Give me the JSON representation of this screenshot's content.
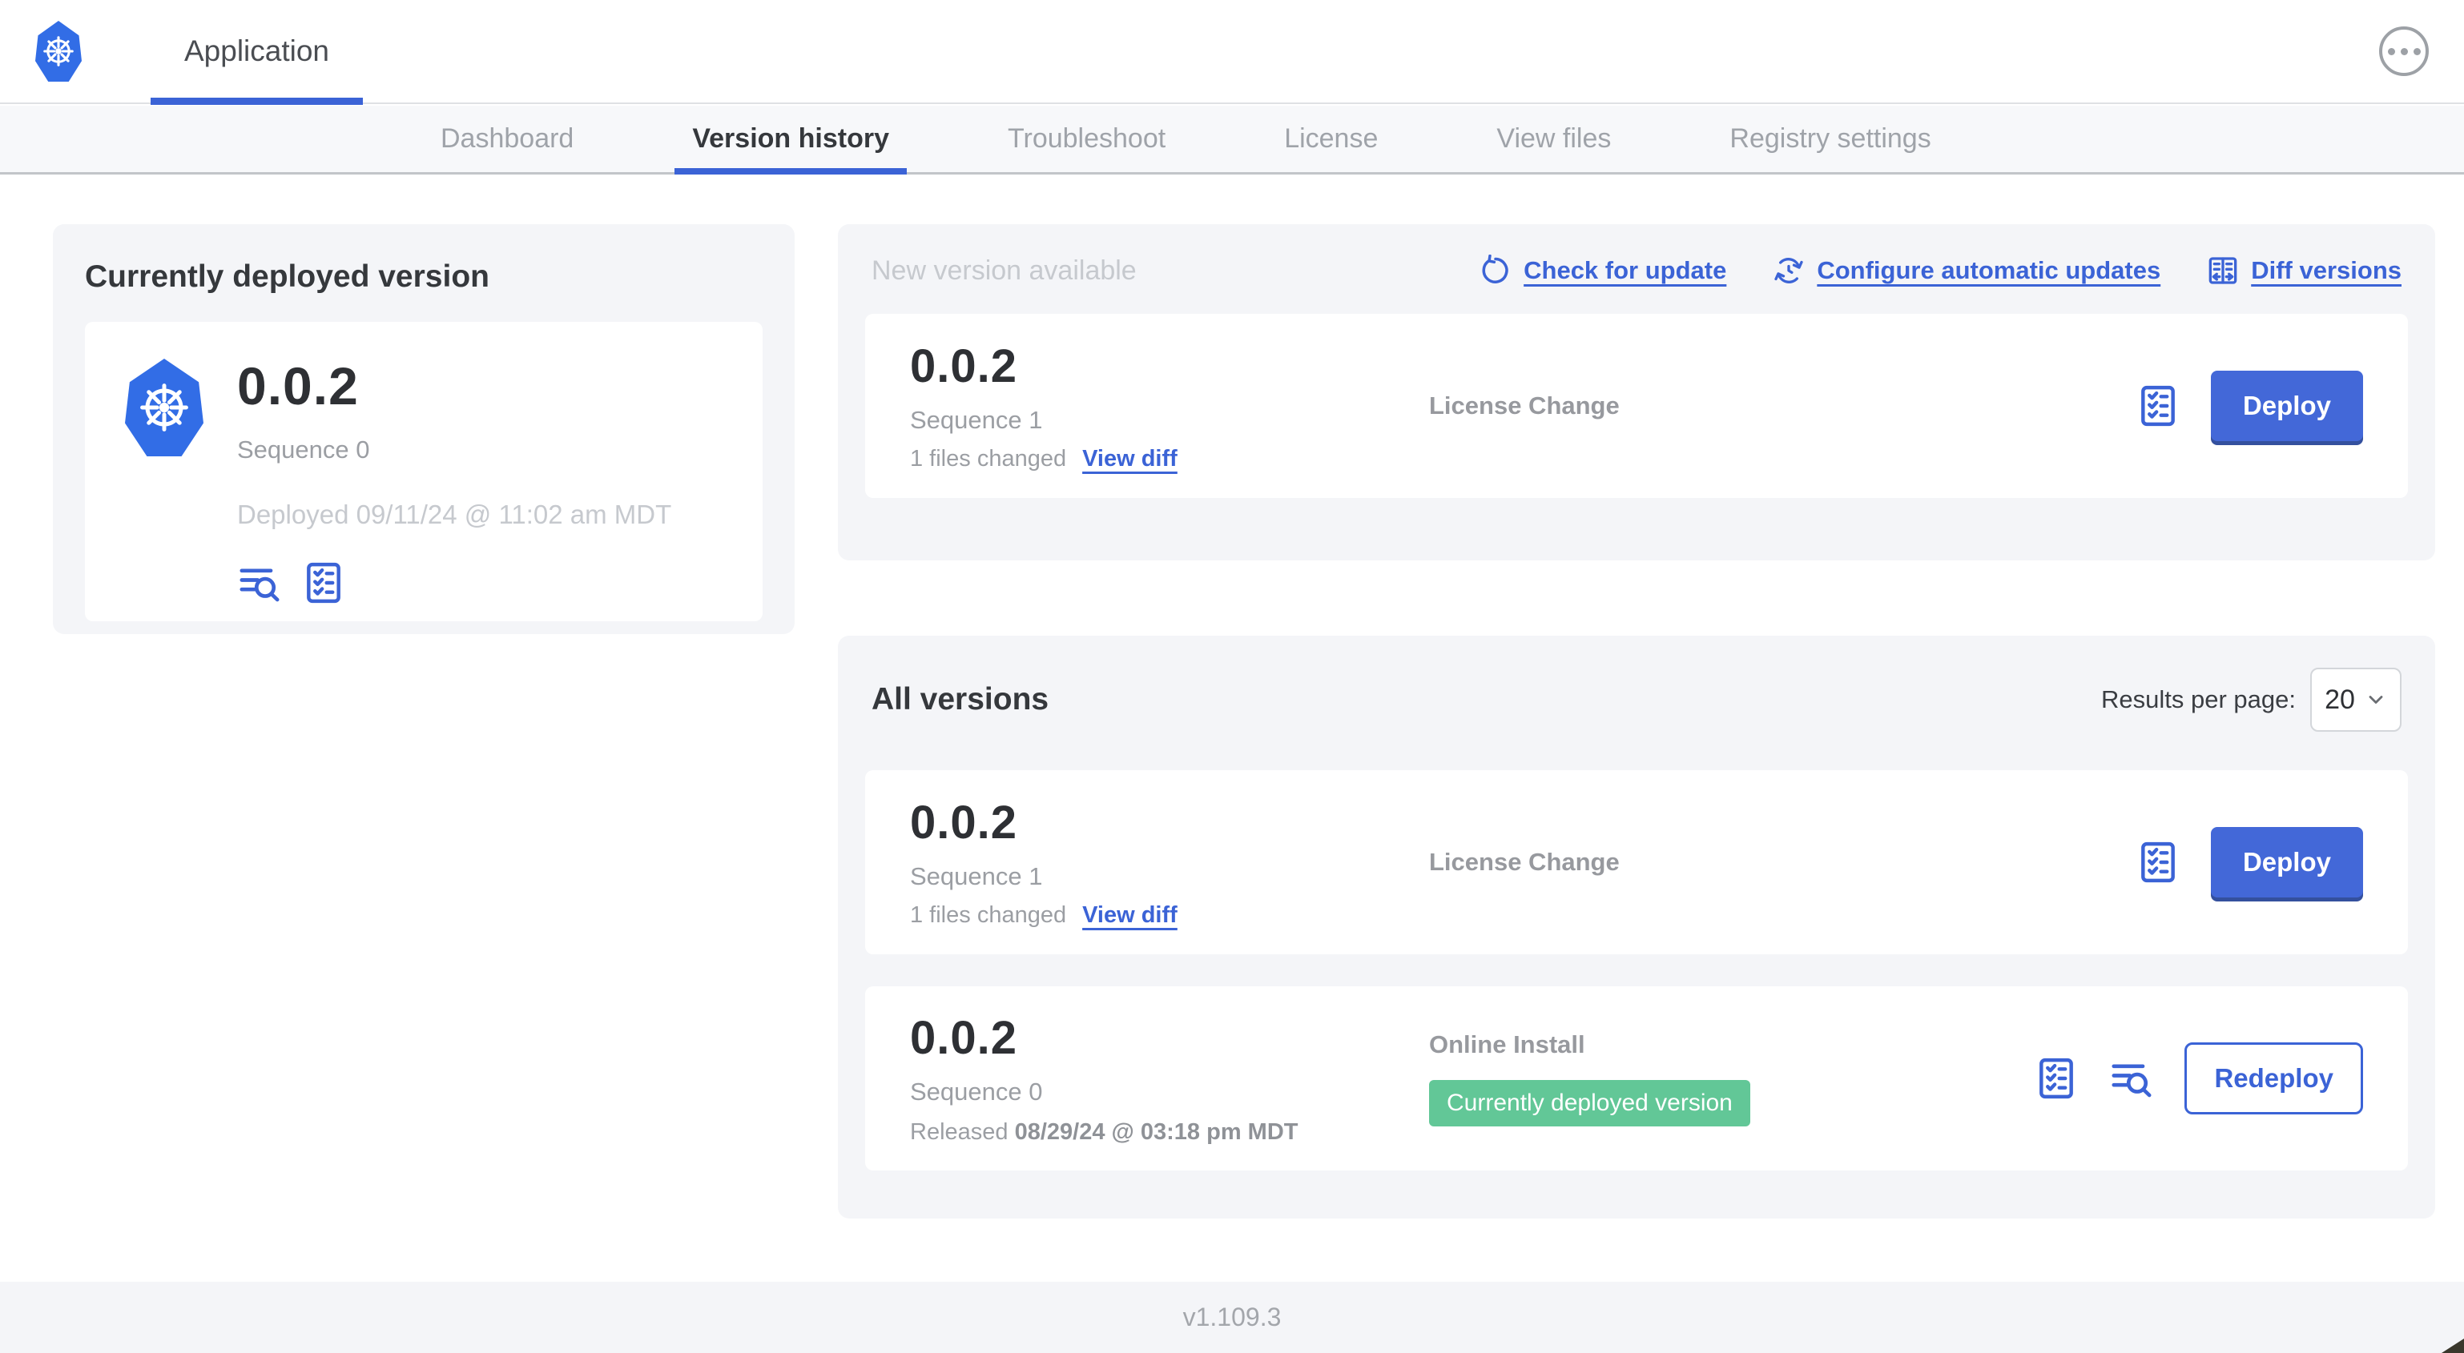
{
  "colors": {
    "accent_blue": "#3b63d6",
    "button_blue": "#4368d8",
    "logo_blue": "#326de6",
    "badge_green": "#62c797",
    "panel_bg": "#f4f5f8",
    "text_dark": "#35383c",
    "text_gray": "#9b9ea3",
    "text_light_gray": "#c6c9ce"
  },
  "icons": {
    "kubernetes-logo": "ship-wheel-in-heptagon",
    "more-menu": "ellipsis-in-circle",
    "view-logs": "text-lines-with-magnifier",
    "preflight-checklist": "clipboard-with-checkmarks",
    "check-update": "circular-refresh-arrow",
    "auto-updates": "clock-with-refresh-arrows",
    "diff-versions": "split-panes-with-arrows",
    "select-chevron": "chevron-down"
  },
  "header": {
    "app_tab_label": "Application"
  },
  "nav": {
    "tabs": [
      {
        "label": "Dashboard"
      },
      {
        "label": "Version history"
      },
      {
        "label": "Troubleshoot"
      },
      {
        "label": "License"
      },
      {
        "label": "View files"
      },
      {
        "label": "Registry settings"
      }
    ]
  },
  "current_version_panel": {
    "title": "Currently deployed version",
    "version": "0.0.2",
    "sequence": "Sequence 0",
    "deployed": "Deployed 09/11/24 @ 11:02 am MDT"
  },
  "new_version_panel": {
    "title": "New version available",
    "check_for_update_label": "Check for update",
    "configure_updates_label": "Configure automatic updates",
    "diff_versions_label": "Diff versions",
    "row": {
      "version": "0.0.2",
      "sequence": "Sequence 1",
      "files_changed": "1 files changed",
      "view_diff_label": "View diff",
      "source": "License Change",
      "action_label": "Deploy"
    }
  },
  "all_versions_panel": {
    "title": "All versions",
    "results_per_page_label": "Results per page:",
    "results_per_page_value": "20",
    "rows": [
      {
        "version": "0.0.2",
        "sequence": "Sequence 1",
        "files_changed": "1 files changed",
        "view_diff_label": "View diff",
        "source": "License Change",
        "action_label": "Deploy"
      },
      {
        "version": "0.0.2",
        "sequence": "Sequence 0",
        "released_prefix": "Released",
        "released_date": "08/29/24 @ 03:18 pm MDT",
        "source": "Online Install",
        "badge": "Currently deployed version",
        "action_label": "Redeploy"
      }
    ]
  },
  "footer": {
    "app_version": "v1.109.3"
  }
}
